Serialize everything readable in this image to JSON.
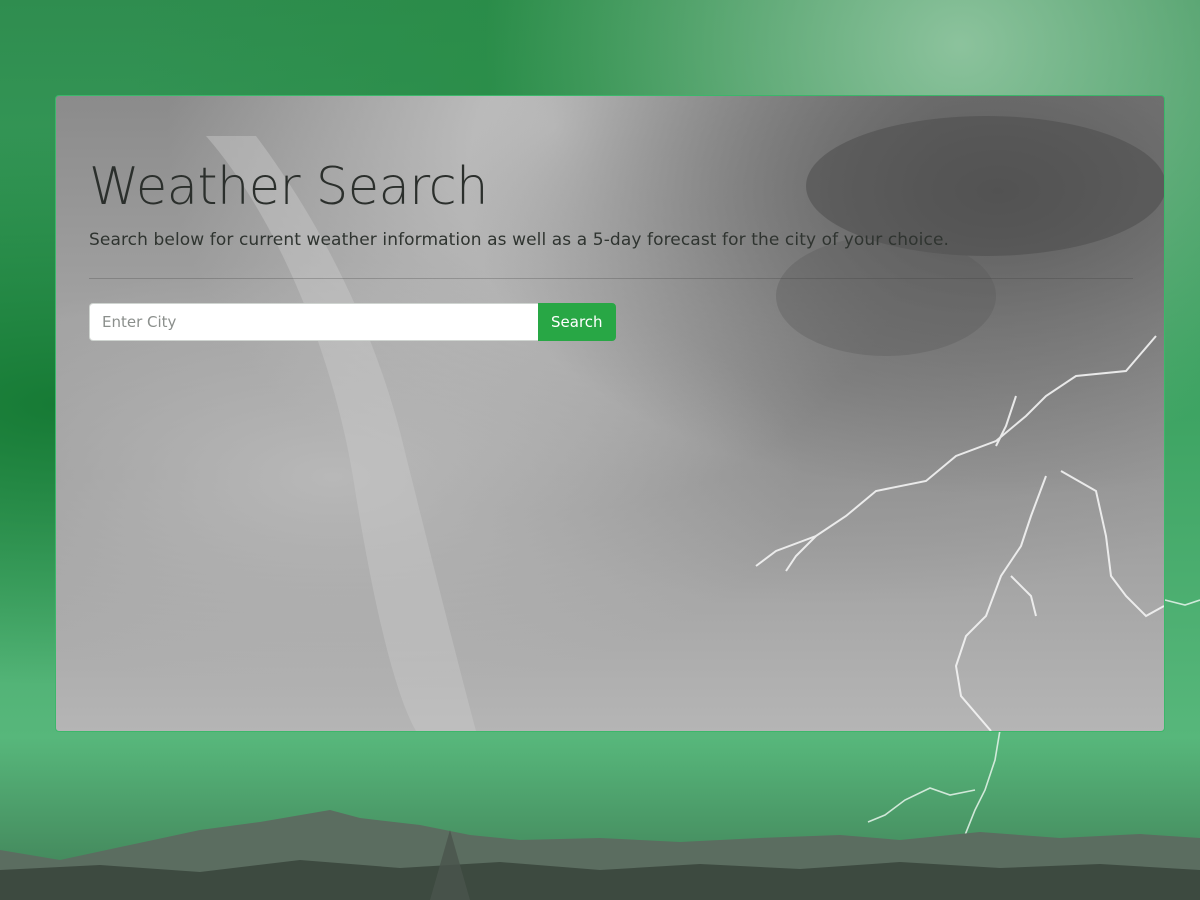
{
  "jumbotron": {
    "title": "Weather Search",
    "lead": "Search below for current weather information as well as a 5-day forecast for the city of your choice."
  },
  "search": {
    "placeholder": "Enter City",
    "value": "",
    "button_label": "Search"
  },
  "colors": {
    "accent": "#28a745",
    "background_tint": "#3aa15f"
  }
}
